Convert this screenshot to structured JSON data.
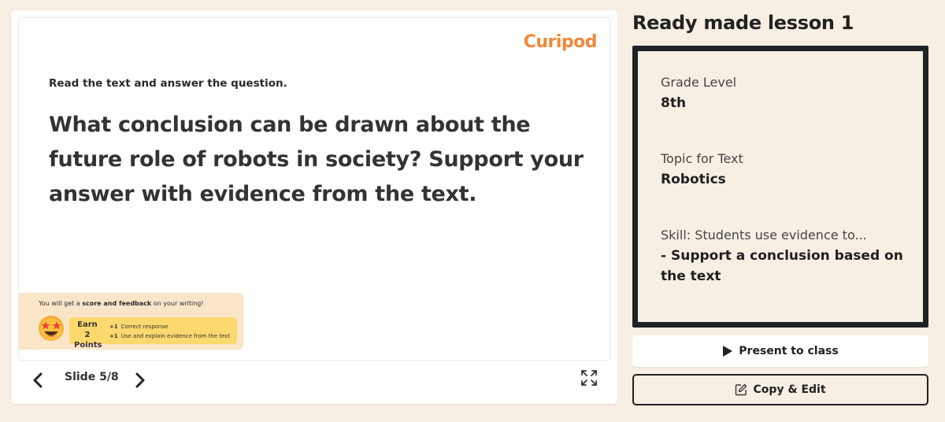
{
  "slide": {
    "logo": "Curipod",
    "instruction": "Read the text and answer the question.",
    "question": "What conclusion can be drawn about the future role of robots in society? Support your answer with evidence from the text.",
    "score": {
      "prefix": "You will get a ",
      "highlight": "score and feedback",
      "suffix": " on your writing!",
      "earn_label": "Earn 2 Points",
      "criteria": [
        {
          "points": "+1",
          "text": "Correct response"
        },
        {
          "points": "+1",
          "text": "Use and explain evidence from the text"
        }
      ]
    }
  },
  "navigation": {
    "counter": "Slide 5/8",
    "prev_icon": "chevron-left-icon",
    "next_icon": "chevron-right-icon",
    "fullscreen_icon": "expand-icon"
  },
  "lesson": {
    "title": "Ready made lesson 1",
    "fields": [
      {
        "label": "Grade Level",
        "value": "8th"
      },
      {
        "label": "Topic for Text",
        "value": "Robotics"
      },
      {
        "label": "Skill: Students use evidence to...",
        "value": "- Support a conclusion based on the text"
      }
    ]
  },
  "actions": {
    "present_label": "Present to class",
    "copy_label": "Copy & Edit"
  },
  "colors": {
    "background": "#f8efe4",
    "brand": "#f0883a",
    "dark": "#1f2226",
    "score_bg": "#fbe5c8",
    "earn_bg": "#fbd96e"
  }
}
